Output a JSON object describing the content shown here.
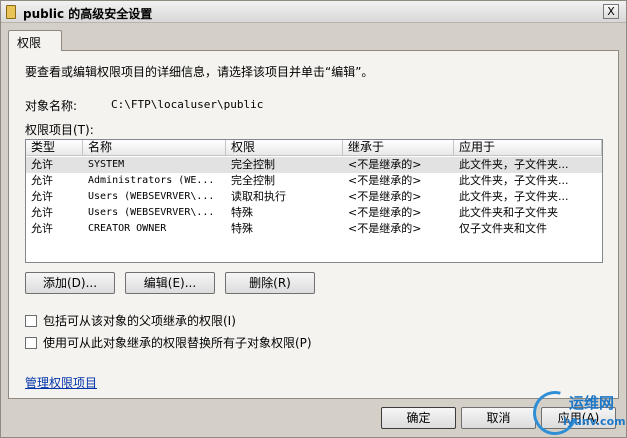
{
  "window": {
    "title": "public 的高级安全设置",
    "close_label": "X"
  },
  "tabs": [
    {
      "label": "权限"
    }
  ],
  "permissions": {
    "description": "要查看或编辑权限项目的详细信息，请选择该项目并单击“编辑”。",
    "object_name_label": "对象名称:",
    "object_name_value": "C:\\FTP\\localuser\\public",
    "entries_label": "权限项目(T):",
    "columns": [
      "类型",
      "名称",
      "权限",
      "继承于",
      "应用于"
    ],
    "rows": [
      {
        "type": "允许",
        "name": "SYSTEM",
        "permission": "完全控制",
        "inherited": "<不是继承的>",
        "applies": "此文件夹，子文件夹..."
      },
      {
        "type": "允许",
        "name": "Administrators (WE...",
        "permission": "完全控制",
        "inherited": "<不是继承的>",
        "applies": "此文件夹，子文件夹..."
      },
      {
        "type": "允许",
        "name": "Users (WEBSEVRVER\\...",
        "permission": "读取和执行",
        "inherited": "<不是继承的>",
        "applies": "此文件夹，子文件夹..."
      },
      {
        "type": "允许",
        "name": "Users (WEBSEVRVER\\...",
        "permission": "特殊",
        "inherited": "<不是继承的>",
        "applies": "此文件夹和子文件夹"
      },
      {
        "type": "允许",
        "name": "CREATOR OWNER",
        "permission": "特殊",
        "inherited": "<不是继承的>",
        "applies": "仅子文件夹和文件"
      }
    ],
    "buttons": {
      "add": "添加(D)...",
      "edit": "编辑(E)...",
      "remove": "删除(R)"
    },
    "checkboxes": {
      "include_inheritable": "包括可从该对象的父项继承的权限(I)",
      "replace_child": "使用可从此对象继承的权限替换所有子对象权限(P)"
    },
    "manage_link": "管理权限项目"
  },
  "dialog_buttons": {
    "ok": "确定",
    "cancel": "取消",
    "apply": "应用(A)"
  },
  "watermark": {
    "brand": "运维网",
    "site": "iyunv.com"
  }
}
